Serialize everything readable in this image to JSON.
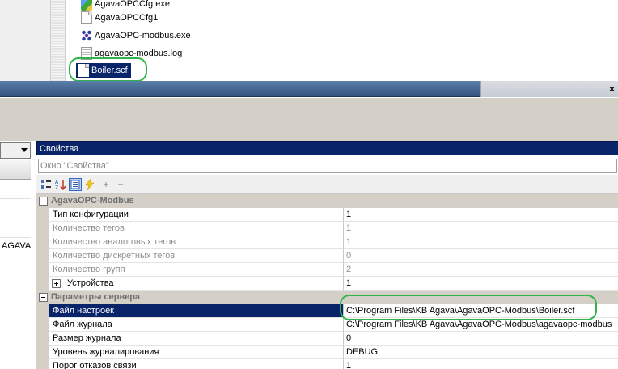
{
  "explorer": {
    "files": [
      {
        "name": "AgavaOPCCfg.exe",
        "icon": "app-config-icon"
      },
      {
        "name": "AgavaOPCCfg1",
        "icon": "document-icon"
      },
      {
        "name": "AgavaOPC-modbus.exe",
        "icon": "modbus-app-icon"
      },
      {
        "name": "agavaopc-modbus.log",
        "icon": "log-file-icon"
      },
      {
        "name": "Boiler.scf",
        "icon": "document-icon",
        "selected": true
      }
    ]
  },
  "window": {
    "close_glyph": "×"
  },
  "left_panel": {
    "truncated_text": "AGAVA"
  },
  "properties": {
    "title": "Свойства",
    "search_placeholder": "Окно \"Свойства\"",
    "toolbar": {
      "categorized_icon": "categorized-icon",
      "alphabetical_icon": "sort-az-icon",
      "properties_icon": "properties-page-icon",
      "events_icon": "lightning-icon",
      "add_label": "+",
      "remove_label": "−"
    },
    "categories": [
      {
        "name": "AgavaOPC-Modbus",
        "rows": [
          {
            "name": "Тип конфигурации",
            "value": "1",
            "disabled": false
          },
          {
            "name": "Количество тегов",
            "value": "1",
            "disabled": true
          },
          {
            "name": "Количество аналоговых тегов",
            "value": "1",
            "disabled": true
          },
          {
            "name": "Количество дискретных тегов",
            "value": "0",
            "disabled": true
          },
          {
            "name": "Количество групп",
            "value": "2",
            "disabled": true
          },
          {
            "name": "Устройства",
            "value": "1",
            "disabled": false,
            "expandable": true
          }
        ]
      },
      {
        "name": "Параметры сервера",
        "rows": [
          {
            "name": "Файл настроек",
            "value": "C:\\Program Files\\KB Agava\\AgavaOPC-Modbus\\Boiler.scf",
            "selected": true
          },
          {
            "name": "Файл журнала",
            "value": "C:\\Program Files\\KB Agava\\AgavaOPC-Modbus\\agavaopc-modbus"
          },
          {
            "name": "Размер журнала",
            "value": "0"
          },
          {
            "name": "Уровень журналирования",
            "value": "DEBUG"
          },
          {
            "name": "Порог отказов связи",
            "value": "1"
          }
        ]
      }
    ]
  },
  "colors": {
    "highlight_ring": "#2fb54a",
    "selection": "#0a246a"
  }
}
